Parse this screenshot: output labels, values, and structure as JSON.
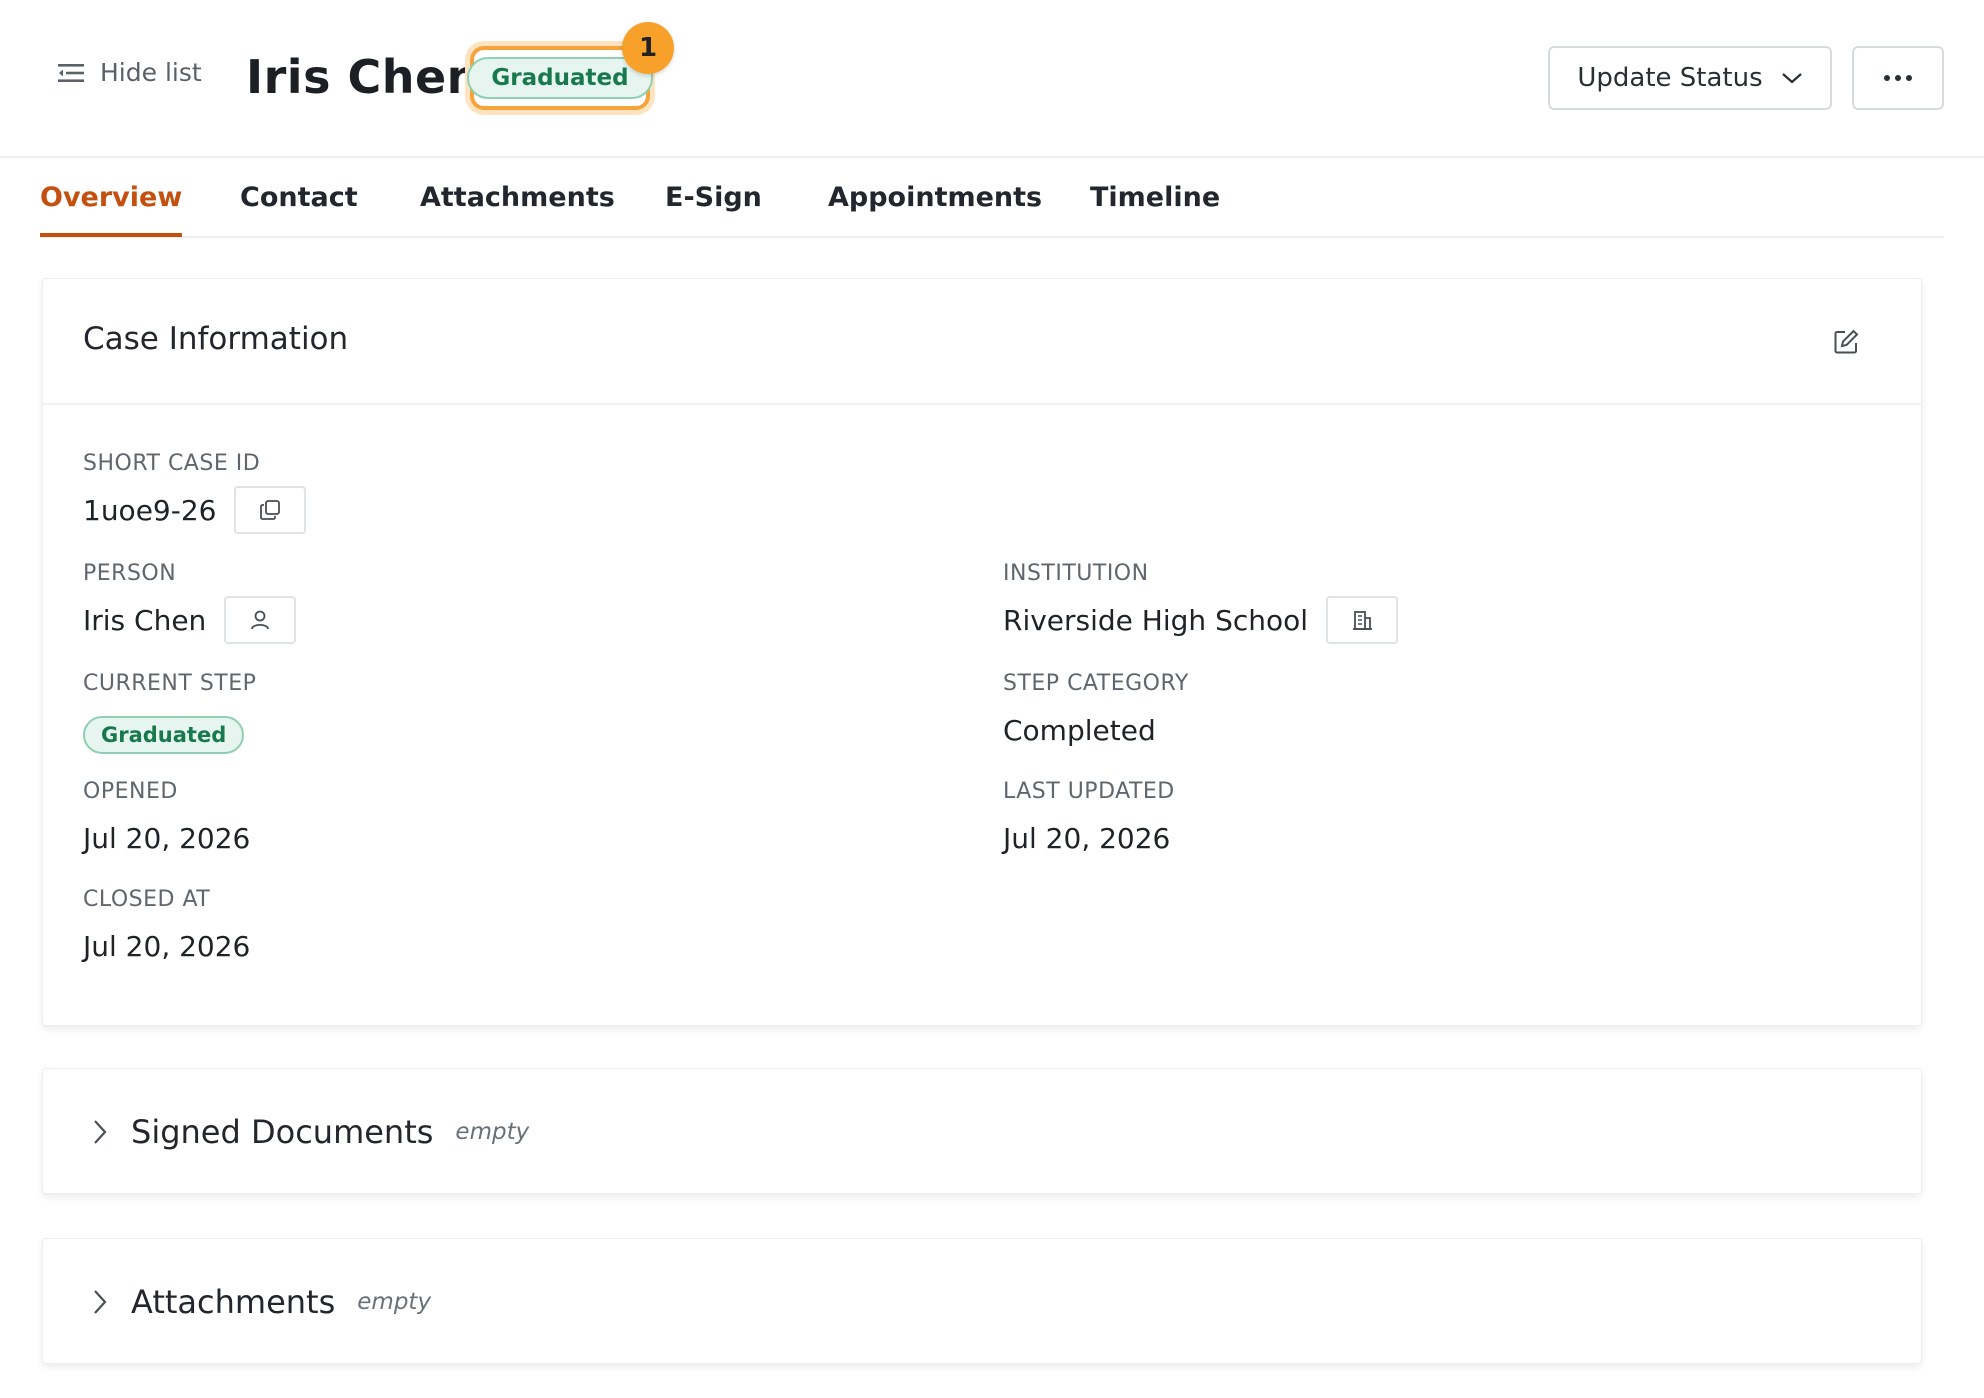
{
  "header": {
    "hide_list_label": "Hide list",
    "person_name": "Iris Chen",
    "status_label": "Graduated",
    "notification_count": "1",
    "update_status_label": "Update Status"
  },
  "tabs": [
    {
      "label": "Overview",
      "active": true
    },
    {
      "label": "Contact"
    },
    {
      "label": "Attachments"
    },
    {
      "label": "E-Sign"
    },
    {
      "label": "Appointments"
    },
    {
      "label": "Timeline"
    }
  ],
  "case_info": {
    "title": "Case Information",
    "short_case_id": {
      "label": "SHORT CASE ID",
      "value": "1uoe9-26"
    },
    "person": {
      "label": "PERSON",
      "value": "Iris Chen"
    },
    "institution": {
      "label": "INSTITUTION",
      "value": "Riverside High School"
    },
    "current_step": {
      "label": "CURRENT STEP",
      "value": "Graduated"
    },
    "step_category": {
      "label": "STEP CATEGORY",
      "value": "Completed"
    },
    "opened": {
      "label": "OPENED",
      "value": "Jul 20, 2026"
    },
    "last_updated": {
      "label": "LAST UPDATED",
      "value": "Jul 20, 2026"
    },
    "closed_at": {
      "label": "CLOSED AT",
      "value": "Jul 20, 2026"
    }
  },
  "sections": {
    "signed_documents": {
      "title": "Signed Documents",
      "empty": "empty"
    },
    "attachments": {
      "title": "Attachments",
      "empty": "empty"
    }
  },
  "colors": {
    "accent": "#c4500f",
    "badge": "#f7a12b",
    "success_bg": "#e6f5ef",
    "success_text": "#18794e"
  }
}
